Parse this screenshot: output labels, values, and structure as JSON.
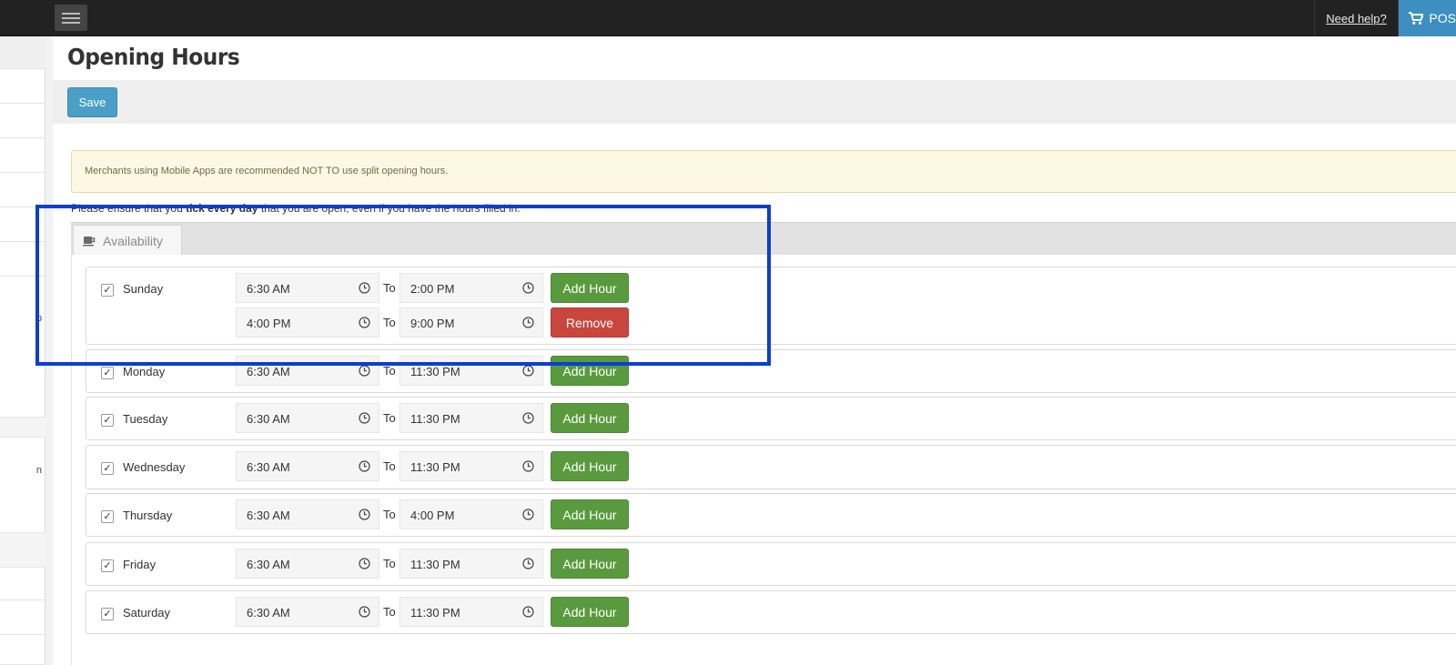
{
  "topbar": {
    "menu_icon": "hamburger-icon",
    "help_link": "Need help?",
    "pos_label": "POS",
    "pos_icon": "cart-icon"
  },
  "sidebar": {
    "fragments": [
      "p",
      "n"
    ]
  },
  "page": {
    "title": "Opening Hours",
    "save_label": "Save"
  },
  "alert": {
    "text": "Merchants using Mobile Apps are recommended NOT TO use split opening hours."
  },
  "notice": {
    "before": "Please ensure that you ",
    "bold": "tick every day",
    "after": " that you are open, even if you have the hours filled in."
  },
  "tab": {
    "label": "Availability",
    "icon": "coffee-cup-icon"
  },
  "to_label": "To",
  "add_hour_label": "Add Hour",
  "remove_label": "Remove",
  "check_mark": "✓",
  "days": [
    {
      "name": "Sunday",
      "checked": true,
      "slots": [
        {
          "from": "6:30 AM",
          "to": "2:00 PM"
        },
        {
          "from": "4:00 PM",
          "to": "9:00 PM"
        }
      ]
    },
    {
      "name": "Monday",
      "checked": true,
      "slots": [
        {
          "from": "6:30 AM",
          "to": "11:30 PM"
        }
      ]
    },
    {
      "name": "Tuesday",
      "checked": true,
      "slots": [
        {
          "from": "6:30 AM",
          "to": "11:30 PM"
        }
      ]
    },
    {
      "name": "Wednesday",
      "checked": true,
      "slots": [
        {
          "from": "6:30 AM",
          "to": "11:30 PM"
        }
      ]
    },
    {
      "name": "Thursday",
      "checked": true,
      "slots": [
        {
          "from": "6:30 AM",
          "to": "4:00 PM"
        }
      ]
    },
    {
      "name": "Friday",
      "checked": true,
      "slots": [
        {
          "from": "6:30 AM",
          "to": "11:30 PM"
        }
      ]
    },
    {
      "name": "Saturday",
      "checked": true,
      "slots": [
        {
          "from": "6:30 AM",
          "to": "11:30 PM"
        }
      ]
    }
  ],
  "colors": {
    "topbar": "#222222",
    "pos_button": "#3d8fc2",
    "save_button": "#4a9fc8",
    "add_button": "#5a9a3e",
    "remove_button": "#c9463d",
    "alert_bg": "#fcf8e3",
    "highlight": "#0a3fd1"
  }
}
